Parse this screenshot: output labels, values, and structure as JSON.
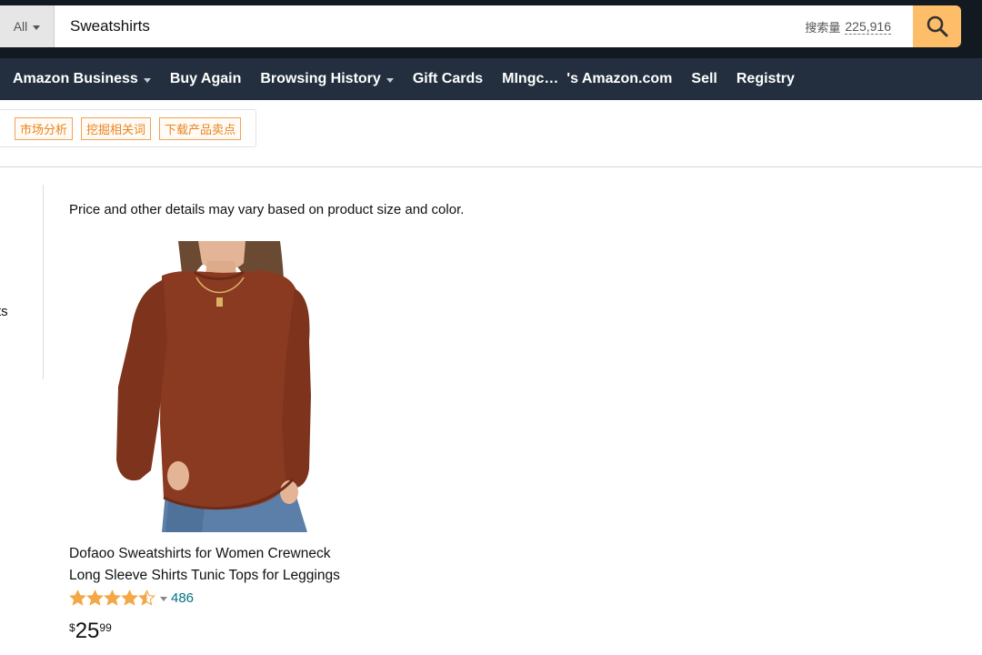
{
  "search": {
    "category": "All",
    "query": "Sweatshirts",
    "volume_label": "搜索量",
    "volume_value": "225,916",
    "search_icon": "magnifier-icon"
  },
  "nav": {
    "items": [
      {
        "label": "Amazon Business",
        "dropdown": true
      },
      {
        "label": "Buy Again",
        "dropdown": false
      },
      {
        "label": "Browsing History",
        "dropdown": true
      },
      {
        "label": "Gift Cards",
        "dropdown": false
      },
      {
        "label": "MIngc…  's Amazon.com",
        "dropdown": false
      },
      {
        "label": "Sell",
        "dropdown": false
      },
      {
        "label": "Registry",
        "dropdown": false
      }
    ]
  },
  "plugin": {
    "tags": [
      "市场分析",
      "挖掘相关词",
      "下载产品卖点"
    ]
  },
  "sidebar": {
    "partial_text": "rts"
  },
  "main": {
    "notice": "Price and other details may vary based on product size and color."
  },
  "product": {
    "title_line1": "Dofaoo Sweatshirts for Women Crewneck",
    "title_line2": "Long Sleeve Shirts Tunic Tops for Leggings",
    "rating": 4.5,
    "review_count": "486",
    "price_symbol": "$",
    "price_whole": "25",
    "price_fraction": "99"
  },
  "colors": {
    "topbar": "#131921",
    "navbar": "#232f3e",
    "search_button": "#febd69",
    "star": "#f3a847",
    "link": "#007185",
    "plugin_accent": "#f0a35a",
    "sweater": "#8b3a22"
  }
}
